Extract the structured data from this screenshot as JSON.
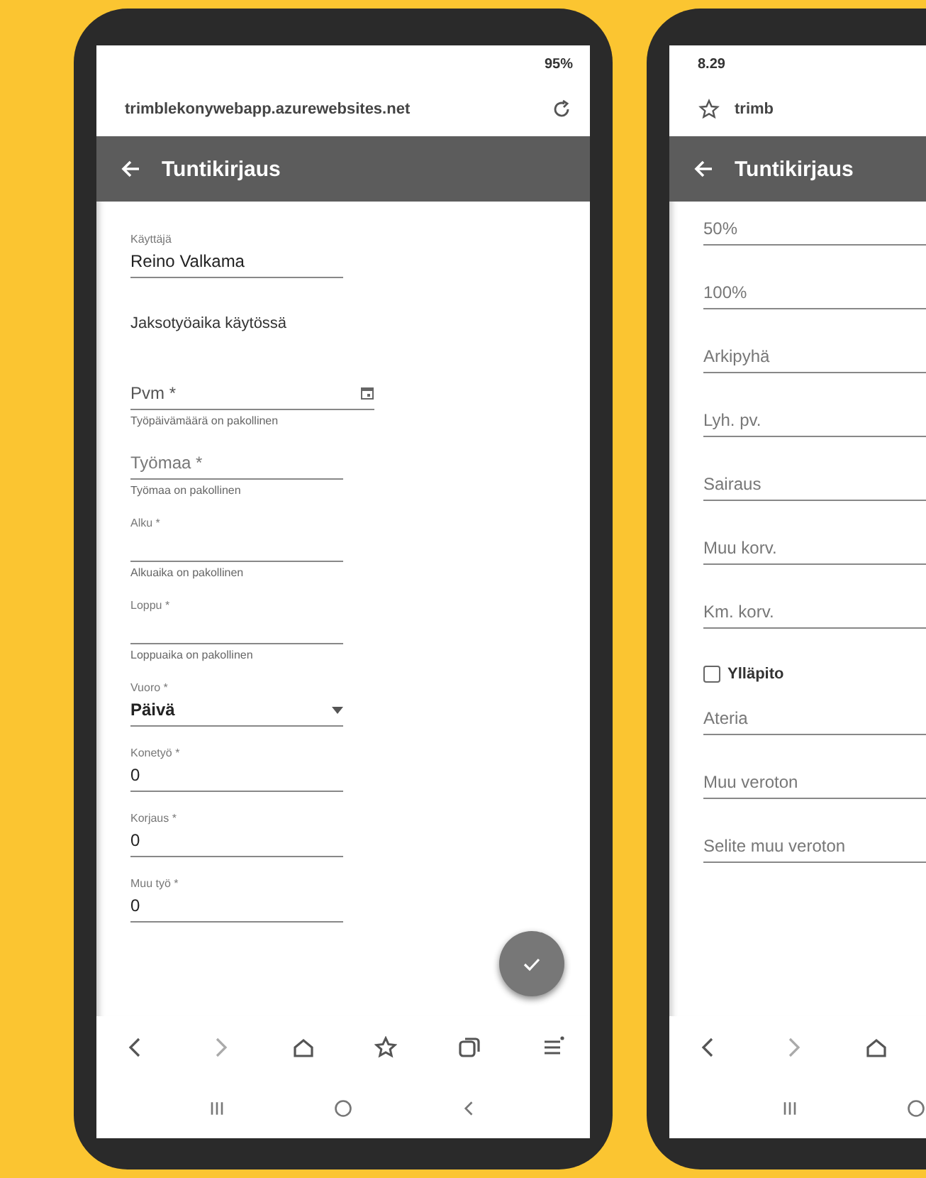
{
  "phones": [
    {
      "status_battery": "95%",
      "url": "trimblekonywebapp.azurewebsites.net",
      "title": "Tuntikirjaus",
      "fab": true,
      "fields": [
        {
          "kind": "value",
          "label": "Käyttäjä",
          "value": "Reino Valkama"
        },
        {
          "kind": "heading",
          "text": "Jaksotyöaika käytössä"
        },
        {
          "kind": "date",
          "placeholder": "Pvm *",
          "error": "Työpäivämäärä on pakollinen"
        },
        {
          "kind": "input",
          "placeholder": "Työmaa *",
          "error": "Työmaa on pakollinen"
        },
        {
          "kind": "value",
          "label": "Alku *",
          "error": "Alkuaika on pakollinen"
        },
        {
          "kind": "value",
          "label": "Loppu *",
          "error": "Loppuaika on pakollinen"
        },
        {
          "kind": "select",
          "label": "Vuoro *",
          "value": "Päivä"
        },
        {
          "kind": "value",
          "label": "Konetyö *",
          "value": "0"
        },
        {
          "kind": "value",
          "label": "Korjaus *",
          "value": "0"
        },
        {
          "kind": "value",
          "label": "Muu työ *",
          "value": "0"
        }
      ]
    },
    {
      "status_time": "8.29",
      "url": "trimb",
      "title": "Tuntikirjaus",
      "fields": [
        {
          "kind": "input",
          "placeholder": "50%"
        },
        {
          "kind": "input",
          "placeholder": "100%"
        },
        {
          "kind": "input",
          "placeholder": "Arkipyhä"
        },
        {
          "kind": "input",
          "placeholder": "Lyh. pv."
        },
        {
          "kind": "input",
          "placeholder": "Sairaus"
        },
        {
          "kind": "input",
          "placeholder": "Muu korv."
        },
        {
          "kind": "input",
          "placeholder": "Km. korv."
        },
        {
          "kind": "checkbox",
          "label": "Ylläpito",
          "checked": false
        },
        {
          "kind": "select",
          "placeholder": "Ateria"
        },
        {
          "kind": "input",
          "placeholder": "Muu veroton"
        },
        {
          "kind": "input",
          "placeholder": "Selite muu veroton"
        }
      ]
    }
  ]
}
